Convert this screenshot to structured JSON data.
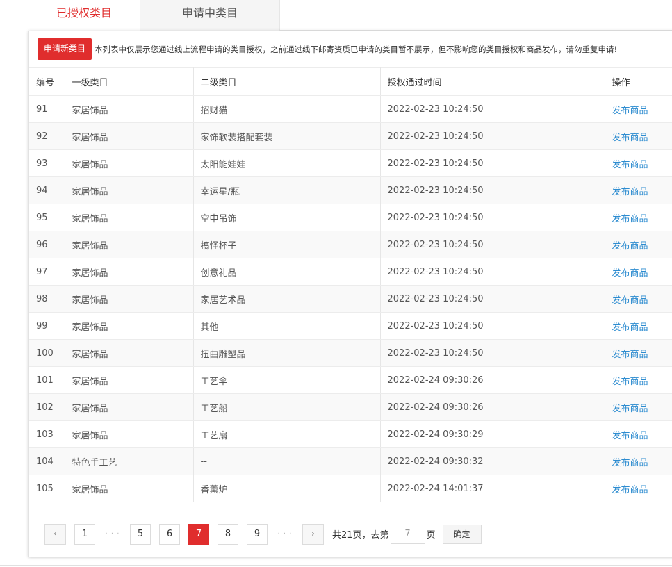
{
  "tabs": [
    {
      "label": "已授权类目",
      "active": true
    },
    {
      "label": "申请中类目",
      "active": false
    }
  ],
  "notice": {
    "button_label": "申请新类目",
    "text": "本列表中仅展示您通过线上流程申请的类目授权，之前通过线下邮寄资质已申请的类目暂不展示，但不影响您的类目授权和商品发布，请勿重复申请!"
  },
  "table": {
    "headers": [
      "编号",
      "一级类目",
      "二级类目",
      "授权通过时间",
      "操作"
    ],
    "rows": [
      {
        "id": "91",
        "cat1": "家居饰品",
        "cat2": "招财猫",
        "time": "2022-02-23 10:24:50",
        "action": "发布商品"
      },
      {
        "id": "92",
        "cat1": "家居饰品",
        "cat2": "家饰软装搭配套装",
        "time": "2022-02-23 10:24:50",
        "action": "发布商品"
      },
      {
        "id": "93",
        "cat1": "家居饰品",
        "cat2": "太阳能娃娃",
        "time": "2022-02-23 10:24:50",
        "action": "发布商品"
      },
      {
        "id": "94",
        "cat1": "家居饰品",
        "cat2": "幸运星/瓶",
        "time": "2022-02-23 10:24:50",
        "action": "发布商品"
      },
      {
        "id": "95",
        "cat1": "家居饰品",
        "cat2": "空中吊饰",
        "time": "2022-02-23 10:24:50",
        "action": "发布商品"
      },
      {
        "id": "96",
        "cat1": "家居饰品",
        "cat2": "搞怪杯子",
        "time": "2022-02-23 10:24:50",
        "action": "发布商品"
      },
      {
        "id": "97",
        "cat1": "家居饰品",
        "cat2": "创意礼品",
        "time": "2022-02-23 10:24:50",
        "action": "发布商品"
      },
      {
        "id": "98",
        "cat1": "家居饰品",
        "cat2": "家居艺术品",
        "time": "2022-02-23 10:24:50",
        "action": "发布商品"
      },
      {
        "id": "99",
        "cat1": "家居饰品",
        "cat2": "其他",
        "time": "2022-02-23 10:24:50",
        "action": "发布商品"
      },
      {
        "id": "100",
        "cat1": "家居饰品",
        "cat2": "扭曲雕塑品",
        "time": "2022-02-23 10:24:50",
        "action": "发布商品"
      },
      {
        "id": "101",
        "cat1": "家居饰品",
        "cat2": "工艺伞",
        "time": "2022-02-24 09:30:26",
        "action": "发布商品"
      },
      {
        "id": "102",
        "cat1": "家居饰品",
        "cat2": "工艺船",
        "time": "2022-02-24 09:30:26",
        "action": "发布商品"
      },
      {
        "id": "103",
        "cat1": "家居饰品",
        "cat2": "工艺扇",
        "time": "2022-02-24 09:30:29",
        "action": "发布商品"
      },
      {
        "id": "104",
        "cat1": "特色手工艺",
        "cat2": "--",
        "time": "2022-02-24 09:30:32",
        "action": "发布商品"
      },
      {
        "id": "105",
        "cat1": "家居饰品",
        "cat2": "香薰炉",
        "time": "2022-02-24 14:01:37",
        "action": "发布商品"
      }
    ]
  },
  "pagination": {
    "prev_icon": "‹",
    "next_icon": "›",
    "ellipsis": "· · ·",
    "pages": [
      "1",
      "5",
      "6",
      "7",
      "8",
      "9"
    ],
    "current": "7",
    "total_text": "共21页，去第",
    "page_suffix": "页",
    "goto_value": "7",
    "confirm_label": "确定"
  },
  "colors": {
    "accent": "#e02d2d",
    "link": "#2d8cd0"
  }
}
